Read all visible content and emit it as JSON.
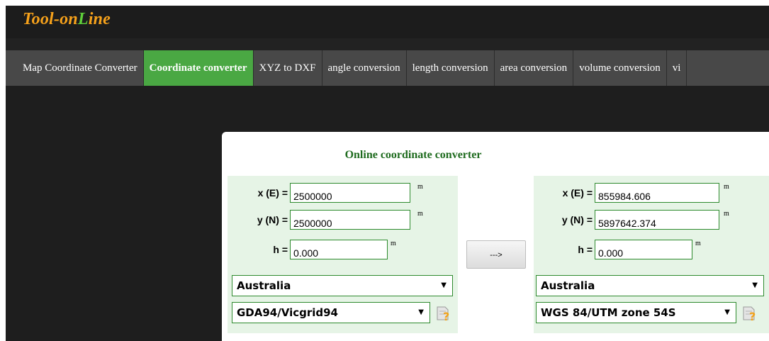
{
  "logo": {
    "part1": "Tool-on",
    "part2": "L",
    "part3": "ine"
  },
  "nav": [
    {
      "label": "Map Coordinate Converter"
    },
    {
      "label": "Coordinate converter"
    },
    {
      "label": "XYZ to DXF"
    },
    {
      "label": "angle conversion"
    },
    {
      "label": "length conversion"
    },
    {
      "label": "area conversion"
    },
    {
      "label": "volume conversion"
    },
    {
      "label": "vi"
    }
  ],
  "converter": {
    "title": "Online coordinate converter",
    "convert_label": "--->",
    "source": {
      "x_label": "x (E) =",
      "x_value": "2500000",
      "x_unit": "m",
      "y_label": "y (N) =",
      "y_value": "2500000",
      "y_unit": "m",
      "h_label": "h =",
      "h_value": "0.000",
      "h_unit": "m",
      "country": "Australia",
      "system": "GDA94/Vicgrid94"
    },
    "target": {
      "x_label": "x (E) =",
      "x_value": "855984.606",
      "x_unit": "m",
      "y_label": "y (N) =",
      "y_value": "5897642.374",
      "y_unit": "m",
      "h_label": "h =",
      "h_value": "0.000",
      "h_unit": "m",
      "country": "Australia",
      "system": "WGS 84/UTM zone 54S"
    }
  },
  "colors": {
    "accent": "#4aa843",
    "nav_bg": "#484848",
    "page_bg": "#1e1e1e",
    "title": "#1e6b1e",
    "logo_orange": "#f7a21b",
    "logo_green": "#5fd03a"
  },
  "icons": {
    "help": "help-icon"
  }
}
